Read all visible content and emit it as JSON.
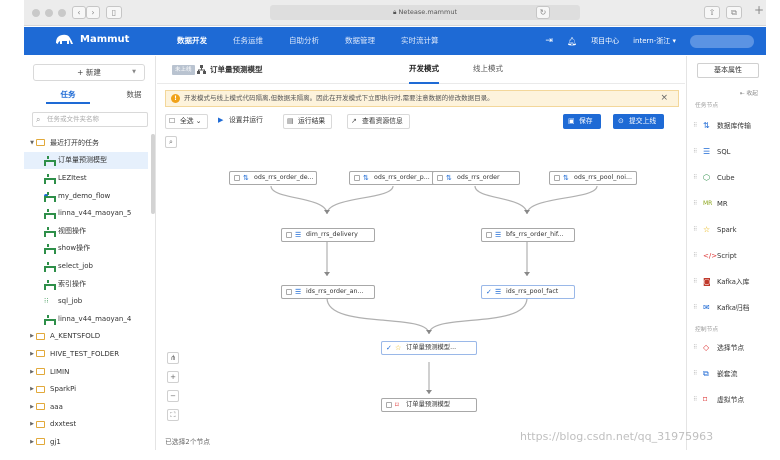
{
  "browser": {
    "url": "Netease.mammut"
  },
  "app": {
    "logo": "Mammut",
    "nav": [
      "数据开发",
      "任务运维",
      "自助分析",
      "数据管理",
      "实时流计算"
    ],
    "project_center": "项目中心",
    "workspace": "intern-浙江"
  },
  "sidebar": {
    "new_button": "+ 新建",
    "tabs": [
      "任务",
      "数据"
    ],
    "search_placeholder": "任务或文件夹名称",
    "tree": [
      {
        "label": "最近打开的任务",
        "type": "folder",
        "level": 0,
        "expanded": true
      },
      {
        "label": "订单量预测模型",
        "type": "flow",
        "level": 1,
        "selected": true
      },
      {
        "label": "LEZItest",
        "type": "flow",
        "level": 1
      },
      {
        "label": "my_demo_flow",
        "type": "flow",
        "level": 1,
        "dot": true
      },
      {
        "label": "linna_v44_maoyan_5",
        "type": "flow",
        "level": 1
      },
      {
        "label": "视图操作",
        "type": "flow",
        "level": 1
      },
      {
        "label": "show操作",
        "type": "flow",
        "level": 1
      },
      {
        "label": "select_job",
        "type": "flow",
        "level": 1
      },
      {
        "label": "索引操作",
        "type": "flow",
        "level": 1
      },
      {
        "label": "sql_job",
        "type": "sql",
        "level": 1
      },
      {
        "label": "linna_v44_maoyan_4",
        "type": "flow",
        "level": 1
      },
      {
        "label": "A_KENTSFOLD",
        "type": "folder",
        "level": 0
      },
      {
        "label": "HIVE_TEST_FOLDER",
        "type": "folder",
        "level": 0
      },
      {
        "label": "LIMIN",
        "type": "folder",
        "level": 0
      },
      {
        "label": "SparkPi",
        "type": "folder",
        "level": 0
      },
      {
        "label": "aaa",
        "type": "folder",
        "level": 0
      },
      {
        "label": "dxxtest",
        "type": "folder",
        "level": 0
      },
      {
        "label": "gj1",
        "type": "folder",
        "level": 0
      }
    ]
  },
  "main": {
    "online_tag": "未上线",
    "title": "订单量预测模型",
    "mode_tabs": [
      "开发模式",
      "线上模式"
    ],
    "warning": "开发模式与线上模式代码隔离,但数据未隔离。因此在开发模式下立即执行时,需要注意数据的修改数据目录。",
    "toolbar": {
      "select_all": "全选",
      "set_run": "设置并运行",
      "run_result": "运行结果",
      "view_resource": "查看资源信息",
      "save": "保存",
      "submit": "提交上线"
    },
    "nodes": [
      {
        "id": "n1",
        "label": "ods_rrs_order_de..."
      },
      {
        "id": "n2",
        "label": "ods_rrs_order_p..."
      },
      {
        "id": "n3",
        "label": "ods_rrs_order"
      },
      {
        "id": "n4",
        "label": "ods_rrs_pool_noi..."
      },
      {
        "id": "n5",
        "label": "dim_rrs_delivery"
      },
      {
        "id": "n6",
        "label": "bfs_rrs_order_hif..."
      },
      {
        "id": "n7",
        "label": "ids_rrs_order_an..."
      },
      {
        "id": "n8",
        "label": "ids_rrs_pool_fact",
        "checked": true
      },
      {
        "id": "n9",
        "label": "订单量预测模型...",
        "checked": true
      },
      {
        "id": "n10",
        "label": "订单量预测模型"
      }
    ],
    "selection_info": "已选择2个节点"
  },
  "right_panel": {
    "basic_props": "基本属性",
    "collapse": "收起",
    "section_task": "任务节点",
    "task_nodes": [
      "数据库传输",
      "SQL",
      "Cube",
      "MR",
      "Spark",
      "Script",
      "Kafka入库",
      "Kafka归档"
    ],
    "section_control": "控制节点",
    "control_nodes": [
      "选择节点",
      "嵌套流",
      "虚拟节点"
    ]
  },
  "watermark": "https://blog.csdn.net/qq_31975963"
}
